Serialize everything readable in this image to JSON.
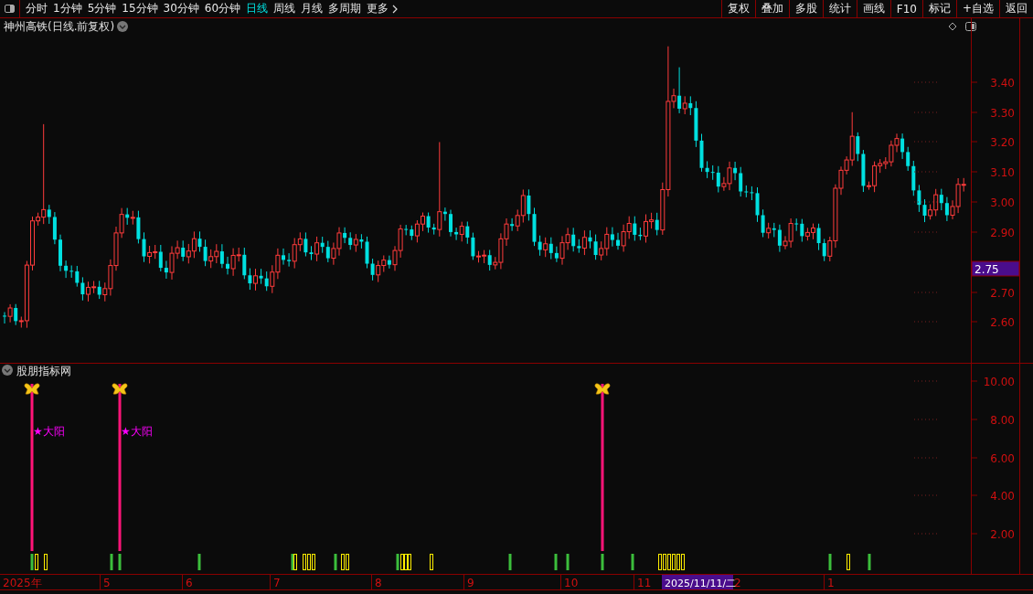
{
  "toolbar": {
    "periods": [
      {
        "label": "分时",
        "selected": false
      },
      {
        "label": "1分钟",
        "selected": false
      },
      {
        "label": "5分钟",
        "selected": false
      },
      {
        "label": "15分钟",
        "selected": false
      },
      {
        "label": "30分钟",
        "selected": false
      },
      {
        "label": "60分钟",
        "selected": false
      },
      {
        "label": "日线",
        "selected": true
      },
      {
        "label": "周线",
        "selected": false
      },
      {
        "label": "月线",
        "selected": false
      },
      {
        "label": "多周期",
        "selected": false
      }
    ],
    "more": "更多",
    "buttons": [
      "复权",
      "叠加",
      "多股",
      "统计",
      "画线",
      "F10",
      "标记",
      "+自选",
      "返回"
    ]
  },
  "chart": {
    "title": "神州高铁(日线.前复权)",
    "price_ticks": [
      "3.40",
      "3.30",
      "3.20",
      "3.10",
      "3.00",
      "2.90",
      "2.70",
      "2.60"
    ],
    "last_price": "2.75"
  },
  "indicator": {
    "title": "股朋指标网",
    "axis_ticks": [
      "10.00",
      "8.00",
      "6.00",
      "4.00",
      "2.00"
    ],
    "signals": [
      {
        "label": "★大阳"
      },
      {
        "label": "★大阳"
      }
    ]
  },
  "time_axis": {
    "labels": [
      "2025年",
      "5",
      "6",
      "7",
      "8",
      "9",
      "10",
      "11",
      "2",
      "1"
    ],
    "cursor_date": "2025/11/11/二"
  }
}
